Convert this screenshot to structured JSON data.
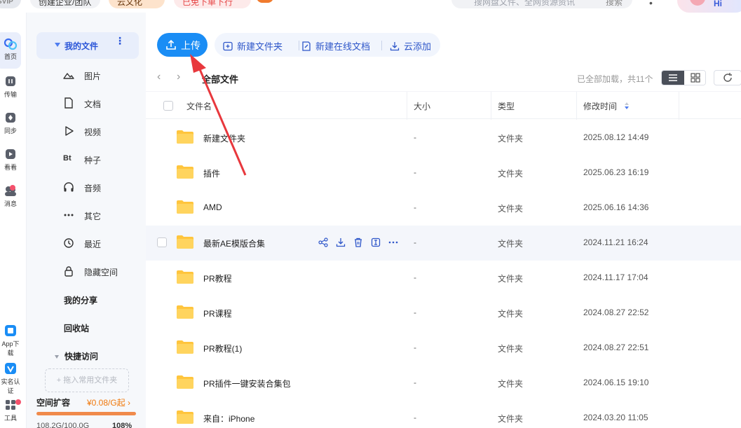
{
  "topbar": {
    "svip_label": "SVIP",
    "team_label": "创建企业/团队",
    "cloud_label": "云文化",
    "promo_label": "已免下单下行",
    "search_placeholder": "搜网盘文件、全网资源资讯",
    "search_button": "搜索",
    "greeting": "Hi"
  },
  "rail": {
    "items": [
      {
        "label": "首页"
      },
      {
        "label": "传输"
      },
      {
        "label": "同步"
      },
      {
        "label": "看看"
      },
      {
        "label": "消息"
      },
      {
        "label": "App下载"
      },
      {
        "label": "实名认证"
      },
      {
        "label": "工具"
      }
    ]
  },
  "sidebar": {
    "my_files": "我的文件",
    "categories": [
      {
        "label": "图片",
        "icon": "image-icon"
      },
      {
        "label": "文档",
        "icon": "document-icon"
      },
      {
        "label": "视频",
        "icon": "video-icon"
      },
      {
        "label": "种子",
        "icon": "torrent-icon",
        "glyph": "Bt"
      },
      {
        "label": "音频",
        "icon": "audio-icon"
      },
      {
        "label": "其它",
        "icon": "more-icon"
      },
      {
        "label": "最近",
        "icon": "history-icon"
      },
      {
        "label": "隐藏空间",
        "icon": "lock-icon"
      }
    ],
    "my_share": "我的分享",
    "recycle_bin": "回收站",
    "quick_access": "快捷访问",
    "drop_hint": "+ 拖入常用文件夹",
    "space_expand": "空间扩容",
    "space_price": "¥0.08/G起",
    "quota_text": "108.2G/100.0G",
    "quota_percent": "108%",
    "quota_fill": 1.0
  },
  "toolbar": {
    "upload": "上传",
    "new_folder": "新建文件夹",
    "new_online_doc": "新建在线文档",
    "cloud_add": "云添加"
  },
  "nav": {
    "breadcrumb": "全部文件",
    "loaded_status": "已全部加载，共11个"
  },
  "table": {
    "headers": {
      "name": "文件名",
      "size": "大小",
      "type": "类型",
      "modified": "修改时间"
    },
    "rows": [
      {
        "name": "新建文件夹",
        "size": "-",
        "type": "文件夹",
        "modified": "2025.08.12 14:49"
      },
      {
        "name": "插件",
        "size": "-",
        "type": "文件夹",
        "modified": "2025.06.23 16:19"
      },
      {
        "name": "AMD",
        "size": "-",
        "type": "文件夹",
        "modified": "2025.06.16 14:36"
      },
      {
        "name": "最新AE模版合集",
        "size": "-",
        "type": "文件夹",
        "modified": "2024.11.21 16:24"
      },
      {
        "name": "PR教程",
        "size": "-",
        "type": "文件夹",
        "modified": "2024.11.17 17:04"
      },
      {
        "name": "PR课程",
        "size": "-",
        "type": "文件夹",
        "modified": "2024.08.27 22:52"
      },
      {
        "name": "PR教程(1)",
        "size": "-",
        "type": "文件夹",
        "modified": "2024.08.27 22:51"
      },
      {
        "name": "PR插件一键安装合集包",
        "size": "-",
        "type": "文件夹",
        "modified": "2024.06.15 19:10"
      },
      {
        "name": "来自：iPhone",
        "size": "-",
        "type": "文件夹",
        "modified": "2024.03.20 11:05"
      }
    ],
    "hover_row": 3
  },
  "colors": {
    "accent": "#1a8df5",
    "annotation_arrow": "#e8383d",
    "folder": "#ffc53d"
  }
}
